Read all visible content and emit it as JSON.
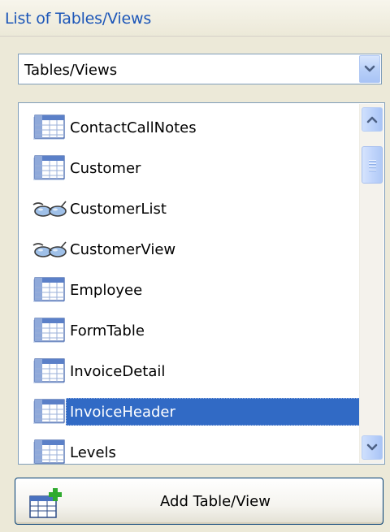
{
  "panel": {
    "title": "List of Tables/Views"
  },
  "dropdown": {
    "selected": "Tables/Views"
  },
  "list": {
    "items": [
      {
        "label": "ContactCallNotes",
        "icon": "table-icon",
        "selected": false
      },
      {
        "label": "Customer",
        "icon": "table-icon",
        "selected": false
      },
      {
        "label": "CustomerList",
        "icon": "view-glasses-icon",
        "selected": false
      },
      {
        "label": "CustomerView",
        "icon": "view-glasses-icon",
        "selected": false
      },
      {
        "label": "Employee",
        "icon": "table-icon",
        "selected": false
      },
      {
        "label": "FormTable",
        "icon": "table-icon",
        "selected": false
      },
      {
        "label": "InvoiceDetail",
        "icon": "table-icon",
        "selected": false
      },
      {
        "label": "InvoiceHeader",
        "icon": "table-icon",
        "selected": true
      },
      {
        "label": "Levels",
        "icon": "table-icon",
        "selected": false
      }
    ]
  },
  "actions": {
    "add_label": "Add Table/View",
    "add_icon": "add-table-icon"
  },
  "colors": {
    "title_text": "#1c56b8",
    "selection": "#316ac5",
    "panel_bg": "#ece9d8",
    "border": "#7f9db9"
  }
}
